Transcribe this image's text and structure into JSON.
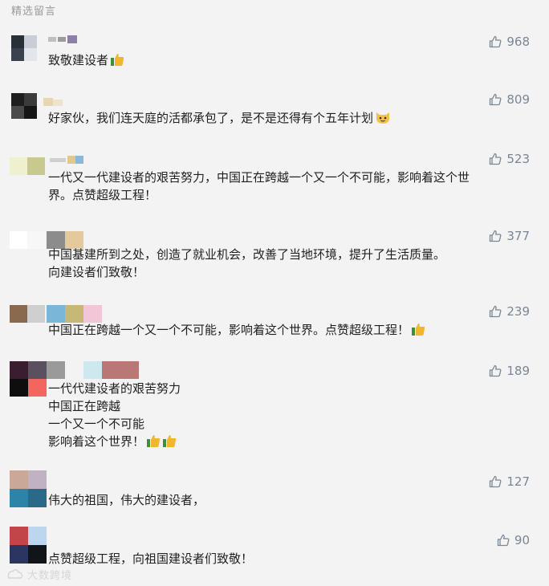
{
  "section": {
    "title": "精选留言"
  },
  "comments": [
    {
      "id": 1,
      "lines": [
        "致敬建设者"
      ],
      "emoji_after_last_line": [
        "thumbs-up"
      ],
      "likes": "968"
    },
    {
      "id": 2,
      "lines": [
        "好家伙，我们连天庭的活都承包了，是不是还得有个五年计划"
      ],
      "emoji_after_last_line": [
        "cat-face"
      ],
      "likes": "809"
    },
    {
      "id": 3,
      "lines": [
        "一代又一代建设者的艰苦努力，中国正在跨越一个又一个不可能，影响着这个世",
        "界。点赞超级工程！"
      ],
      "emoji_after_last_line": [],
      "likes": "523"
    },
    {
      "id": 4,
      "lines": [
        "中国基建所到之处，创造了就业机会，改善了当地环境，提升了生活质量。",
        "向建设者们致敬！"
      ],
      "emoji_after_last_line": [],
      "likes": "377"
    },
    {
      "id": 5,
      "lines": [
        "中国正在跨越一个又一个不可能，影响着这个世界。点赞超级工程！"
      ],
      "emoji_after_last_line": [
        "thumbs-up"
      ],
      "likes": "239"
    },
    {
      "id": 6,
      "lines": [
        "一代代建设者的艰苦努力",
        "中国正在跨越",
        "一个又一个不可能",
        "影响着这个世界！"
      ],
      "emoji_after_last_line": [
        "thumbs-up",
        "thumbs-up"
      ],
      "likes": "189"
    },
    {
      "id": 7,
      "lines": [
        "伟大的祖国，伟大的建设者，"
      ],
      "emoji_after_last_line": [],
      "likes": "127"
    },
    {
      "id": 8,
      "lines": [
        "点赞超级工程，向祖国建设者们致敬！"
      ],
      "emoji_after_last_line": [],
      "likes": "90"
    }
  ],
  "watermark": {
    "text": "大数跨境"
  },
  "icons": {
    "like": "thumbs-up-outline-icon",
    "emoji_thumb": "thumbs-up-emoji",
    "emoji_cat": "cat-face-emoji"
  },
  "colors": {
    "background": "#f3f3f3",
    "text": "#1f1f1f",
    "like_count": "#7a8694",
    "title": "#9a9a9a"
  }
}
